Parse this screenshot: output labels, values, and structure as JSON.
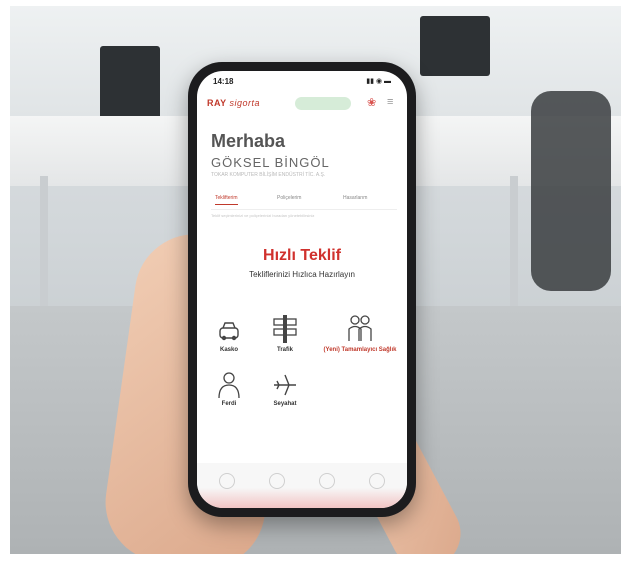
{
  "phone": {
    "status_time": "14:18",
    "status_icons": "▮▮ ◉ ▬",
    "logo": "RAY",
    "logo_tail": "sigorta",
    "greeting": "Merhaba",
    "user_name": "GÖKSEL BİNGÖL",
    "subtitle": "TOKAR KOMPUTER BİLİŞİM ENDÜSTRİ TİC. A.Ş.",
    "tabs": [
      "Teklifterim",
      "Poliçelerim",
      "Hasarlarım"
    ],
    "tab_note": "Teklif seçimlerinizi ve poliçelerinizi buradan yönetebilirsiniz",
    "title": "Hızlı Teklif",
    "tagline": "Tekliflerinizi Hızlıca Hazırlayın",
    "categories": [
      {
        "label": "Kasko",
        "icon": "car-icon"
      },
      {
        "label": "Trafik",
        "icon": "traffic-sign-icon"
      },
      {
        "label": "(Yeni) Tamamlayıcı Sağlık",
        "icon": "family-icon"
      },
      {
        "label": "Ferdi",
        "icon": "person-icon"
      },
      {
        "label": "Seyahat",
        "icon": "airplane-icon"
      }
    ],
    "accent": "#d0312d"
  }
}
